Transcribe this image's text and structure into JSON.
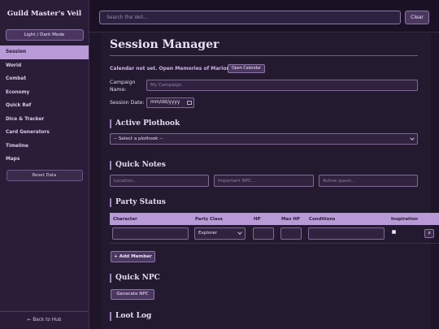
{
  "sidebar": {
    "brand": "Guild Master's Veil",
    "mode_toggle": "Light / Dark Mode",
    "items": [
      {
        "label": "Session"
      },
      {
        "label": "World"
      },
      {
        "label": "Combat"
      },
      {
        "label": "Economy"
      },
      {
        "label": "Quick Ref"
      },
      {
        "label": "Dice & Tracker"
      },
      {
        "label": "Card Generators"
      },
      {
        "label": "Timeline"
      },
      {
        "label": "Maps"
      }
    ],
    "active_item": "Session",
    "reset": "Reset Data",
    "back": "← Back to Hub"
  },
  "topbar": {
    "search_placeholder": "Search the Veil...",
    "clear": "Clear"
  },
  "main": {
    "title": "Session Manager",
    "calendar_text": "Calendar not set. Open Memories of Marion.",
    "calendar_button": "Open Calendar",
    "campaign_label": "Campaign Name:",
    "campaign_placeholder": "My Campaign",
    "date_label": "Session Date:",
    "date_value": "mm/dd/yyyy",
    "plothook_heading": "Active Plothook",
    "plothook_select": "-- Select a plothook --",
    "notes_heading": "Quick Notes",
    "notes_placeholders": {
      "location": "Location...",
      "npc": "Important NPC...",
      "quest": "Active quest..."
    },
    "party_heading": "Party Status",
    "party_columns": [
      "Character",
      "Party Class",
      "HP",
      "Max HP",
      "Conditions",
      "Inspiration"
    ],
    "party_row": {
      "class": "Explorer",
      "remove": "x"
    },
    "add_member": "+ Add Member",
    "npc_heading": "Quick NPC",
    "generate_npc": "Generate NPC",
    "loot_heading": "Loot Log"
  },
  "colors": {
    "accent": "#b79ad6",
    "background": "#1f1528",
    "sidebar": "#2a1d38"
  }
}
